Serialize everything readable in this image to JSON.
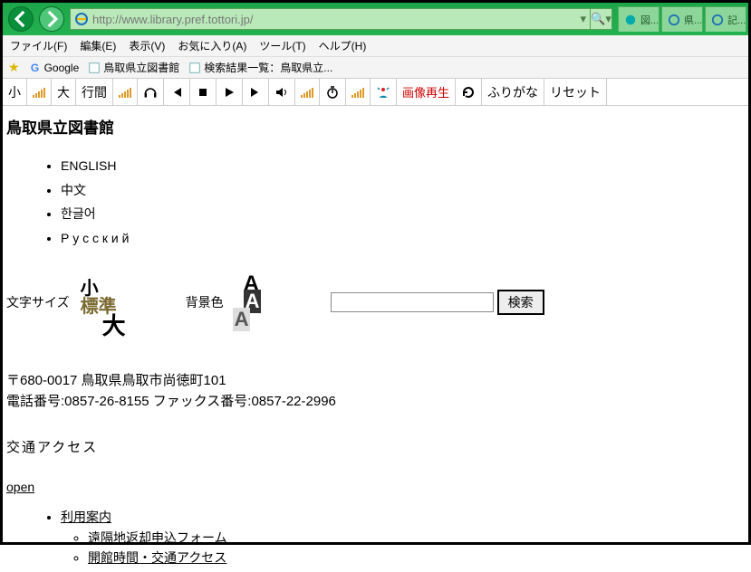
{
  "browser": {
    "url": "http://www.library.pref.tottori.jp/",
    "search_symbol": "🔍",
    "tabs": [
      {
        "label": "図..."
      },
      {
        "label": "県..."
      },
      {
        "label": "記..."
      }
    ]
  },
  "menus": {
    "file": "ファイル(F)",
    "edit": "編集(E)",
    "view": "表示(V)",
    "favorites": "お気に入り(A)",
    "tools": "ツール(T)",
    "help": "ヘルプ(H)"
  },
  "favorites_bar": {
    "google": "Google",
    "link1": "鳥取県立図書館",
    "link2": "検索結果一覧：鳥取県立..."
  },
  "toolbar": {
    "small": "小",
    "large": "大",
    "line": "行間",
    "img_regen": "画像再生",
    "furigana": "ふりがな",
    "reset": "リセット"
  },
  "site": {
    "title": "鳥取県立図書館",
    "langs": [
      "ENGLISH",
      "中文",
      "한글어",
      "Р у с с к и й"
    ],
    "font_size_label": "文字サイズ",
    "font_bg_label": "背景色",
    "size_small": "小",
    "size_kanji": "標準",
    "size_big": "大",
    "bg_a": "A",
    "search_label": "検索",
    "address_line1": "〒680-0017 鳥取県鳥取市尚徳町101",
    "address_line2": "電話番号:0857-26-8155 ファックス番号:0857-22-2996",
    "access": "交通アクセス",
    "open": "open",
    "guide": "利用案内",
    "guide_sub1": "遠隔地返却申込フォーム",
    "guide_sub2": "開館時間・交通アクセス"
  }
}
